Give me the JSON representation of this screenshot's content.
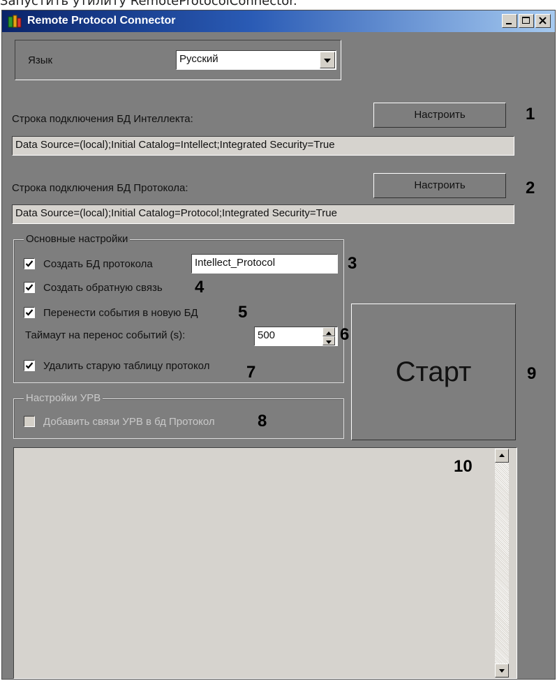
{
  "page_caption": "Запустить утилиту RemoteProtocolConnector.",
  "window": {
    "title": "Remote Protocol Connector",
    "icon": "app-icon",
    "buttons": [
      "minimize-icon",
      "maximize-icon",
      "close-icon"
    ]
  },
  "language": {
    "label": "Язык",
    "value": "Русский"
  },
  "intellect_db": {
    "label": "Строка подключения БД Интеллекта:",
    "button": "Настроить",
    "value": "Data Source=(local);Initial Catalog=Intellect;Integrated Security=True",
    "callout": "1"
  },
  "protocol_db": {
    "label": "Строка подключения БД Протокола:",
    "button": "Настроить",
    "value": "Data Source=(local);Initial Catalog=Protocol;Integrated Security=True",
    "callout": "2"
  },
  "main_settings": {
    "title": "Основные настройки",
    "create_db": {
      "label": "Создать БД протокола",
      "checked": true,
      "value": "Intellect_Protocol",
      "callout": "3"
    },
    "create_feedback": {
      "label": "Создать обратную связь",
      "checked": true,
      "callout": "4"
    },
    "move_events": {
      "label": "Перенести события в новую БД",
      "checked": true,
      "callout": "5"
    },
    "timeout": {
      "label": "Таймаут на перенос событий (s):",
      "value": "500",
      "callout": "6"
    },
    "delete_old": {
      "label": "Удалить старую таблицу протокол",
      "checked": true,
      "callout": "7"
    }
  },
  "urv_settings": {
    "title": "Настройки УРВ",
    "add_links": {
      "label": "Добавить связи УРВ в бд Протокол",
      "checked": false,
      "enabled": false,
      "callout": "8"
    }
  },
  "start": {
    "label": "Старт",
    "callout": "9"
  },
  "log": {
    "callout": "10"
  }
}
